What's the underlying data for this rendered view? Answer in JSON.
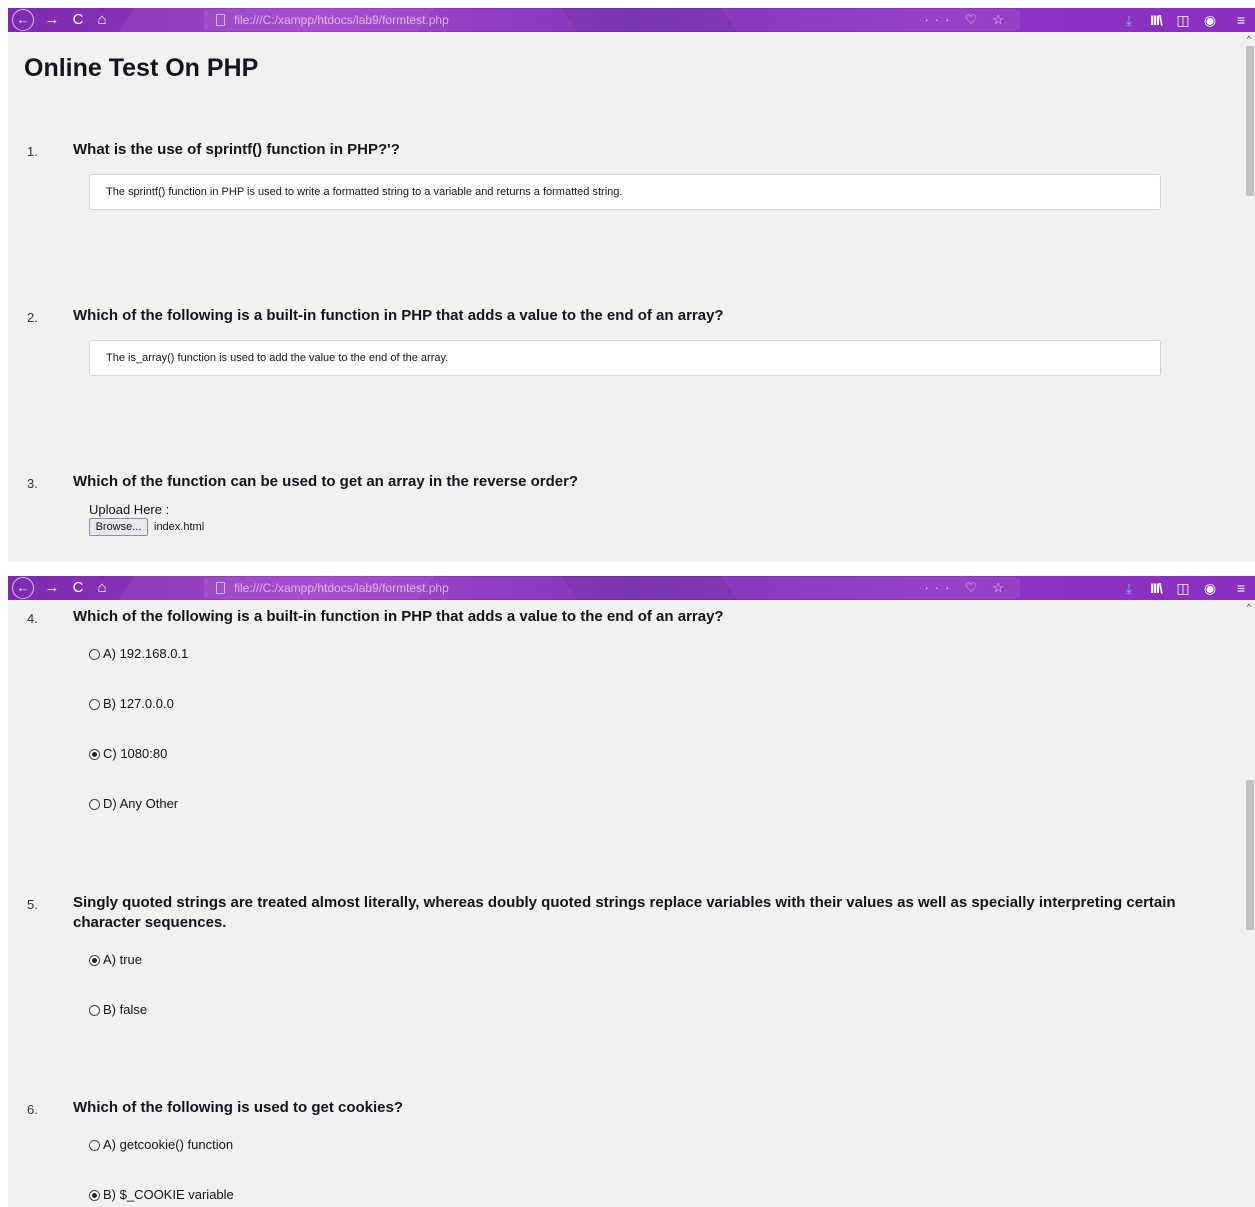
{
  "browser": {
    "url": "file:///C:/xampp/htdocs/lab9/formtest.php",
    "icons": {
      "back": "back-arrow-icon",
      "forward": "forward-arrow-icon",
      "reload": "reload-icon",
      "home": "home-icon",
      "page_actions": "more-actions-icon",
      "pocket": "pocket-icon",
      "bookmark": "star-icon",
      "download": "download-icon",
      "library": "library-icon",
      "sidebar": "sidebar-icon",
      "account": "account-icon",
      "menu": "hamburger-menu-icon"
    },
    "glyphs": {
      "back": "←",
      "forward": "→",
      "reload": "C",
      "home": "⌂",
      "page_actions": "··· ♡ ☆",
      "download": "⤓",
      "library": "III\\",
      "sidebar": "◫",
      "account": "◉",
      "menu": "≡"
    },
    "theme_color": "#8a2fc0",
    "scroll_up_glyph": "^"
  },
  "page": {
    "title": "Online Test On PHP"
  },
  "questions": [
    {
      "number": "1.",
      "text": "What is the use of sprintf() function in PHP?'?",
      "answer": "The sprintf() function in PHP is used to write a formatted string to a variable and returns a formatted string."
    },
    {
      "number": "2.",
      "text": "Which of the following is a built-in function in PHP that adds a value to the end of an array?",
      "answer": "The is_array() function is used to add the value to the end of the array."
    },
    {
      "number": "3.",
      "text": "Which of the function can be used to get an array in the reverse order?",
      "upload_label": "Upload Here :",
      "browse_label": "Browse...",
      "file_name": "index.html"
    },
    {
      "number": "4.",
      "text": "Which of the following is a built-in function in PHP that adds a value to the end of an array?",
      "options": [
        {
          "label": "A) 192.168.0.1",
          "checked": false
        },
        {
          "label": "B) 127.0.0.0",
          "checked": false
        },
        {
          "label": "C) 1080:80",
          "checked": true
        },
        {
          "label": "D) Any Other",
          "checked": false
        }
      ]
    },
    {
      "number": "5.",
      "text": "Singly quoted strings are treated almost literally, whereas doubly quoted strings replace variables with their values as well as specially interpreting certain character sequences.",
      "options": [
        {
          "label": "A) true",
          "checked": true
        },
        {
          "label": "B) false",
          "checked": false
        }
      ]
    },
    {
      "number": "6.",
      "text": "Which of the following is used to get cookies?",
      "options": [
        {
          "label": "A) getcookie() function",
          "checked": false
        },
        {
          "label": "B) $_COOKIE variable",
          "checked": true
        }
      ]
    }
  ]
}
